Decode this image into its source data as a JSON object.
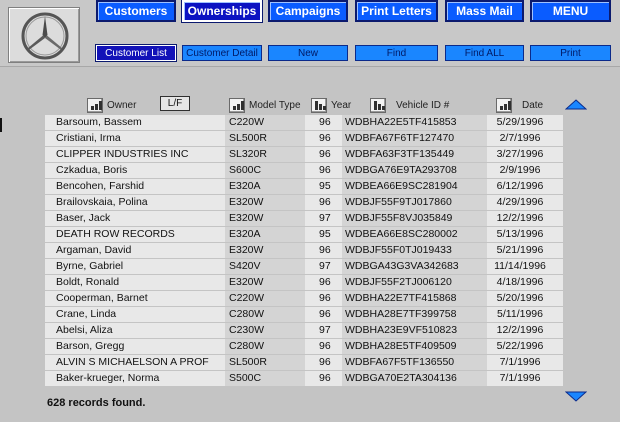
{
  "nav": {
    "buttons": [
      "Customers",
      "Ownerships",
      "Campaigns",
      "Print Letters",
      "Mass Mail",
      "MENU"
    ],
    "active": "Ownerships"
  },
  "subnav": {
    "buttons": [
      "Customer List",
      "Customer Detail",
      "New",
      "Find",
      "Find ALL",
      "Print"
    ],
    "active": "Customer List"
  },
  "columns": {
    "owner": "Owner",
    "lf": "L/F",
    "model": "Model Type",
    "year": "Year",
    "vin": "Vehicle ID #",
    "date": "Date"
  },
  "rows": [
    {
      "owner": "Barsoum, Bassem",
      "model": "C220W",
      "year": "96",
      "vin": "WDBHA22E5TF415853",
      "date": "5/29/1996"
    },
    {
      "owner": "Cristiani, Irma",
      "model": "SL500R",
      "year": "96",
      "vin": "WDBFA67F6TF127470",
      "date": "2/7/1996"
    },
    {
      "owner": "CLIPPER INDUSTRIES INC",
      "model": "SL320R",
      "year": "96",
      "vin": "WDBFA63F3TF135449",
      "date": "3/27/1996"
    },
    {
      "owner": "Czkadua, Boris",
      "model": "S600C",
      "year": "96",
      "vin": "WDBGA76E9TA293708",
      "date": "2/9/1996"
    },
    {
      "owner": "Bencohen, Farshid",
      "model": "E320A",
      "year": "95",
      "vin": "WDBEA66E9SC281904",
      "date": "6/12/1996"
    },
    {
      "owner": "Brailovskaia, Polina",
      "model": "E320W",
      "year": "96",
      "vin": "WDBJF55F9TJ017860",
      "date": "4/29/1996"
    },
    {
      "owner": "Baser, Jack",
      "model": "E320W",
      "year": "97",
      "vin": "WDBJF55F8VJ035849",
      "date": "12/2/1996"
    },
    {
      "owner": "DEATH ROW RECORDS",
      "model": "E320A",
      "year": "95",
      "vin": "WDBEA66E8SC280002",
      "date": "5/13/1996"
    },
    {
      "owner": "Argaman, David",
      "model": "E320W",
      "year": "96",
      "vin": "WDBJF55F0TJ019433",
      "date": "5/21/1996"
    },
    {
      "owner": "Byrne, Gabriel",
      "model": "S420V",
      "year": "97",
      "vin": "WDBGA43G3VA342683",
      "date": "11/14/1996"
    },
    {
      "owner": "Boldt, Ronald",
      "model": "E320W",
      "year": "96",
      "vin": "WDBJF55F2TJ006120",
      "date": "4/18/1996"
    },
    {
      "owner": "Cooperman, Barnet",
      "model": "C220W",
      "year": "96",
      "vin": "WDBHA22E7TF415868",
      "date": "5/20/1996"
    },
    {
      "owner": "Crane, Linda",
      "model": "C280W",
      "year": "96",
      "vin": "WDBHA28E7TF399758",
      "date": "5/11/1996"
    },
    {
      "owner": "Abelsi, Aliza",
      "model": "C230W",
      "year": "97",
      "vin": "WDBHA23E9VF510823",
      "date": "12/2/1996"
    },
    {
      "owner": "Barson, Gregg",
      "model": "C280W",
      "year": "96",
      "vin": "WDBHA28E5TF409509",
      "date": "5/22/1996"
    },
    {
      "owner": "ALVIN S MICHAELSON A PROF",
      "model": "SL500R",
      "year": "96",
      "vin": "WDBFA67F5TF136550",
      "date": "7/1/1996"
    },
    {
      "owner": "Baker-krueger, Norma",
      "model": "S500C",
      "year": "96",
      "vin": "WDBGA70E2TA304136",
      "date": "7/1/1996"
    }
  ],
  "status": "628 records found.",
  "icons": {
    "logo": "mercedes-star-logo-icon",
    "sort": "sort-bars-icon",
    "scroll_up": "scroll-up-arrow-icon",
    "scroll_down": "scroll-down-arrow-icon"
  },
  "colors": {
    "nav_blue": "#0a5cff",
    "nav_active": "#0c13c2",
    "sub_blue": "#1a86ff",
    "background": "#c4c4c4"
  }
}
